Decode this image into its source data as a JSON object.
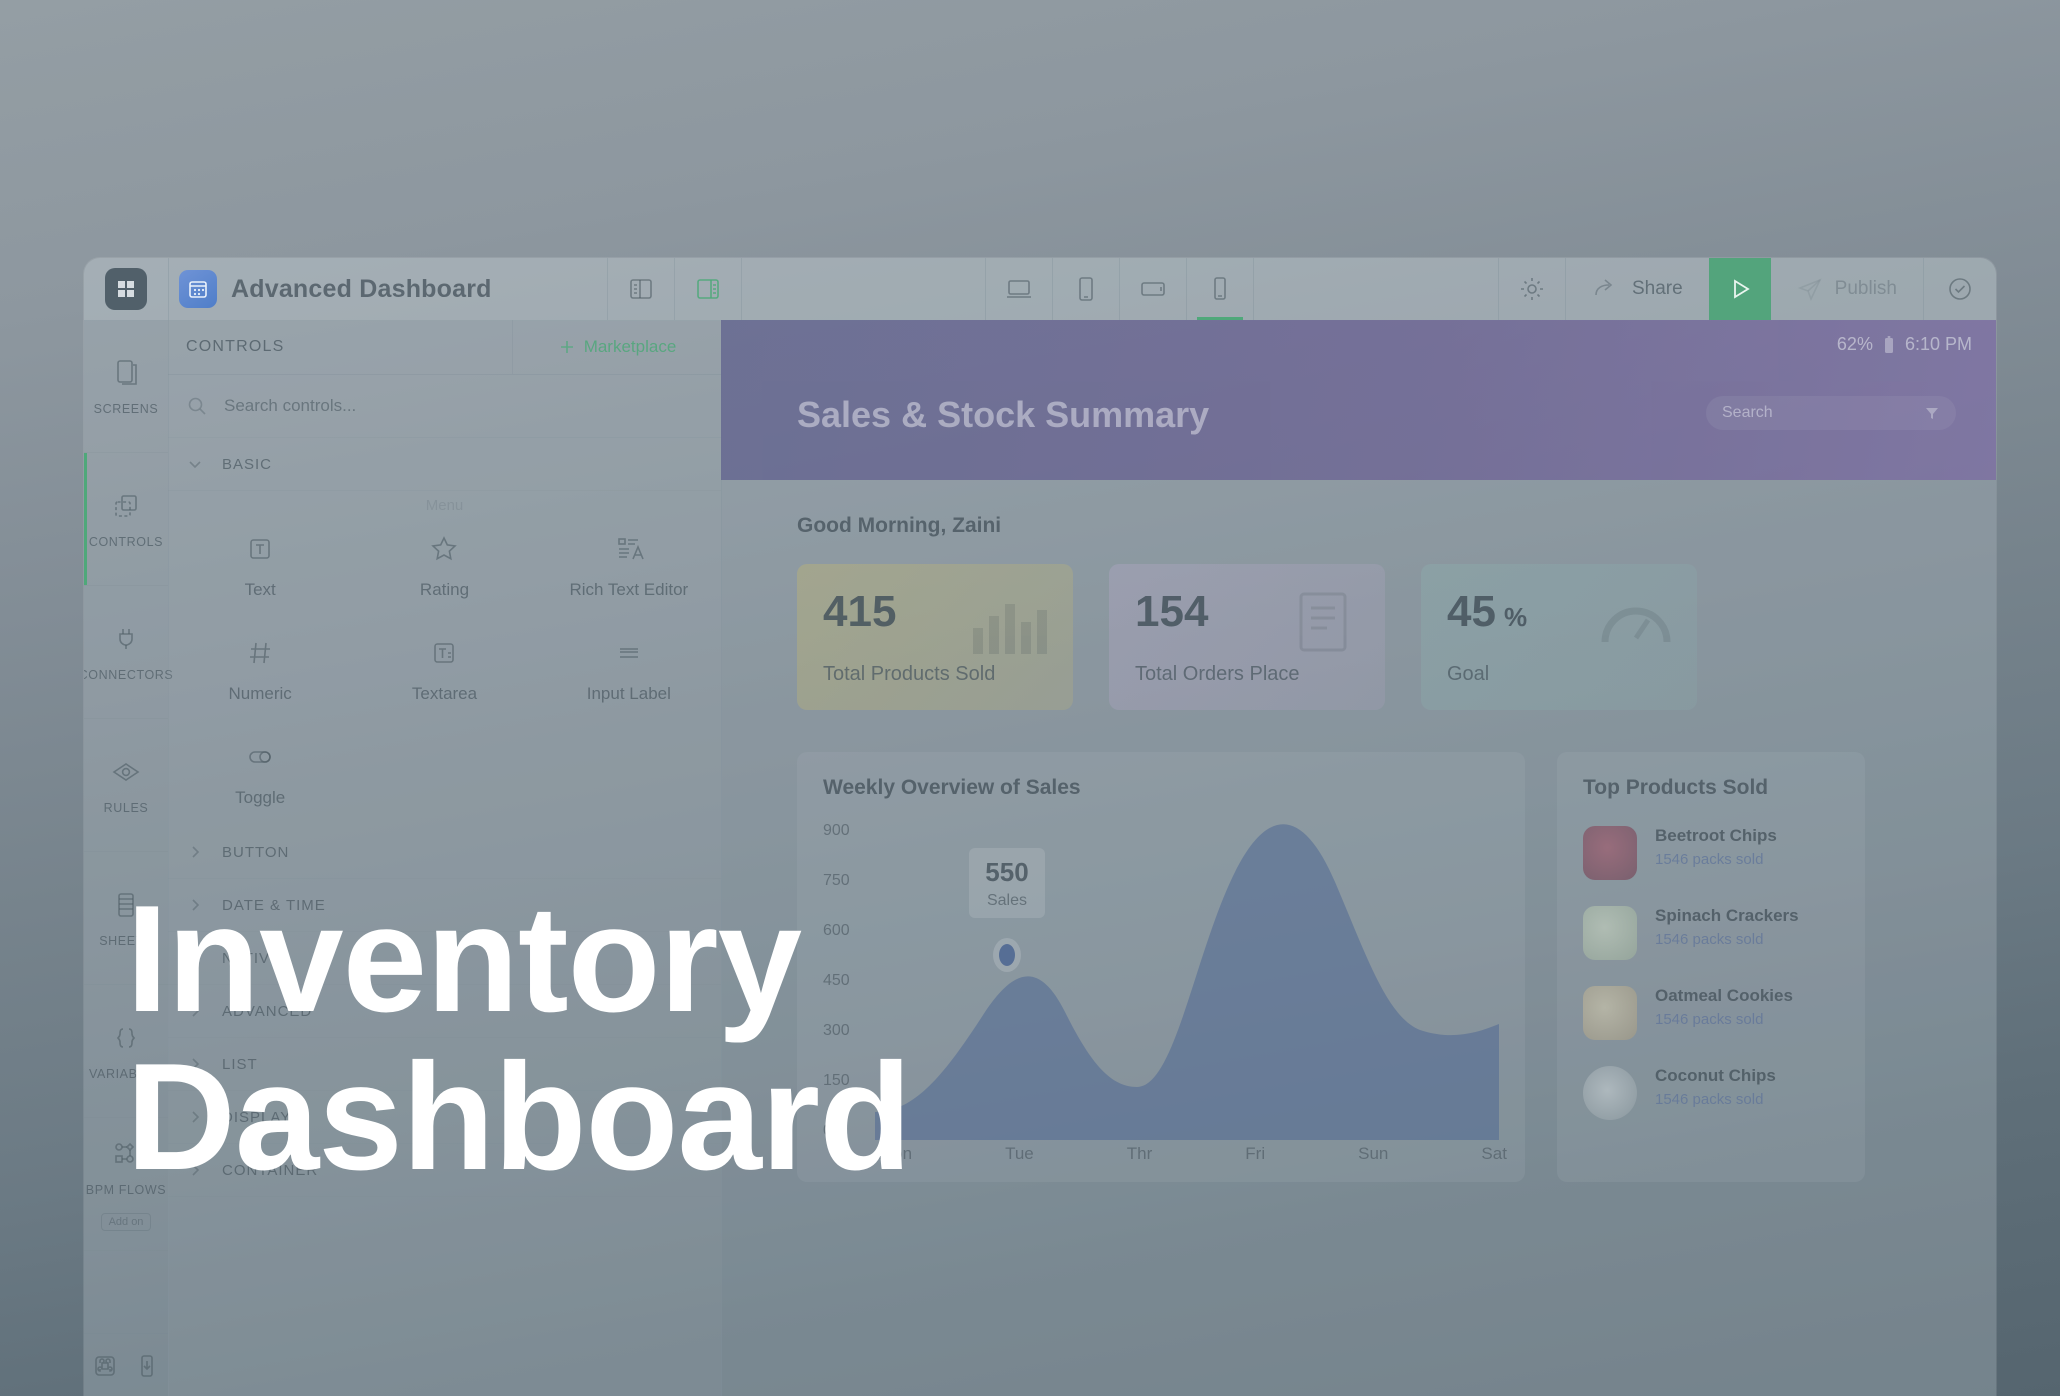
{
  "overlay": {
    "line1": "Inventory",
    "line2": "Dashboard",
    "color": "#ffffff"
  },
  "toolbar": {
    "app_title": "Advanced Dashboard",
    "app_icon": "calendar-app-icon",
    "logo_icon": "brand-logo-icon",
    "layout_buttons": [
      {
        "name": "layout-left-panel-icon",
        "active": false
      },
      {
        "name": "layout-split-panel-icon",
        "active": true
      }
    ],
    "devices": [
      {
        "name": "desktop-icon",
        "active": false
      },
      {
        "name": "tablet-icon",
        "active": false
      },
      {
        "name": "tablet-landscape-icon",
        "active": false
      },
      {
        "name": "mobile-icon",
        "active": true
      }
    ],
    "settings_icon": "gear-icon",
    "share_label": "Share",
    "share_icon": "share-arrow-icon",
    "play_icon": "play-icon",
    "play_bg": "#53a47c",
    "publish_label": "Publish",
    "publish_icon": "paper-plane-icon",
    "check_icon": "check-circle-icon"
  },
  "rail": {
    "items": [
      {
        "label": "SCREENS",
        "icon": "screens-icon",
        "active": false
      },
      {
        "label": "CONTROLS",
        "icon": "controls-icon",
        "active": true
      },
      {
        "label": "CONNECTORS",
        "icon": "plug-icon",
        "active": false
      },
      {
        "label": "RULES",
        "icon": "eye-rules-icon",
        "active": false
      },
      {
        "label": "SHEETS",
        "icon": "sheets-icon",
        "active": false
      },
      {
        "label": "VARIABLES",
        "icon": "braces-icon",
        "active": false
      },
      {
        "label": "BPM FLOWS",
        "icon": "flow-nodes-icon",
        "active": false
      }
    ],
    "badge": "Add on",
    "bottom_icons": [
      "command-icon",
      "download-mobile-icon"
    ]
  },
  "panel": {
    "title": "CONTROLS",
    "marketplace_label": "Marketplace",
    "marketplace_icon": "plus-icon",
    "search_placeholder": "Search controls...",
    "search_icon": "search-icon",
    "basic_label": "BASIC",
    "basic_chevron": "chevron-down-icon",
    "menu_ghost": "Menu",
    "controls": [
      {
        "label": "Text",
        "icon": "text-box-icon"
      },
      {
        "label": "Rating",
        "icon": "star-icon"
      },
      {
        "label": "Rich Text Editor",
        "icon": "rich-text-icon"
      },
      {
        "label": "Numeric",
        "icon": "hash-icon"
      },
      {
        "label": "Textarea",
        "icon": "textarea-icon"
      },
      {
        "label": "Input Label",
        "icon": "input-label-icon"
      },
      {
        "label": "Toggle",
        "icon": "toggle-icon"
      }
    ],
    "groups": [
      {
        "label": "BUTTON",
        "icon": "chevron-right-icon"
      },
      {
        "label": "DATE & TIME",
        "icon": "chevron-right-icon"
      },
      {
        "label": "NATIVE",
        "icon": "chevron-right-icon"
      },
      {
        "label": "ADVANCED",
        "icon": "chevron-right-icon"
      },
      {
        "label": "LIST",
        "icon": "chevron-right-icon"
      },
      {
        "label": "DISPLAY",
        "icon": "chevron-right-icon"
      },
      {
        "label": "CONTAINER",
        "icon": "chevron-right-icon"
      }
    ]
  },
  "preview": {
    "status": {
      "battery": "62%",
      "battery_icon": "battery-icon",
      "time": "6:10 PM"
    },
    "header_title": "Sales & Stock Summary",
    "header_color": "#6a5f93",
    "search_placeholder": "Search",
    "filter_icon": "filter-icon",
    "greeting": "Good Morning, Zaini",
    "stat_cards": [
      {
        "value": "415",
        "unit": "",
        "label": "Total Products Sold",
        "ghost_icon": "bar-chart-icon"
      },
      {
        "value": "154",
        "unit": "",
        "label": "Total Orders Place",
        "ghost_icon": "receipt-icon"
      },
      {
        "value": "45",
        "unit": "%",
        "label": "Goal",
        "ghost_icon": "gauge-icon"
      }
    ],
    "chart_title": "Weekly Overview of Sales",
    "tooltip": {
      "value": "550",
      "label": "Sales"
    },
    "products_title": "Top Products Sold",
    "products": [
      {
        "name": "Beetroot Chips",
        "meta": "1546 packs sold",
        "thumb": "beetroot-chips-thumb"
      },
      {
        "name": "Spinach Crackers",
        "meta": "1546 packs sold",
        "thumb": "spinach-crackers-thumb"
      },
      {
        "name": "Oatmeal Cookies",
        "meta": "1546 packs sold",
        "thumb": "oatmeal-cookies-thumb"
      },
      {
        "name": "Coconut Chips",
        "meta": "1546 packs sold",
        "thumb": "coconut-chips-thumb"
      }
    ]
  },
  "chart_data": {
    "type": "area",
    "title": "Weekly Overview of Sales",
    "xlabel": "",
    "ylabel": "",
    "categories": [
      "Mon",
      "Tue",
      "Thr",
      "Fri",
      "Sun",
      "Sat"
    ],
    "series": [
      {
        "name": "Sales",
        "values": [
          120,
          550,
          180,
          900,
          330,
          300
        ]
      }
    ],
    "yticks": [
      "900",
      "750",
      "600",
      "450",
      "300",
      "150",
      "0"
    ],
    "ylim": [
      0,
      900
    ],
    "grid": false,
    "legend": "none",
    "highlight": {
      "category": "Tue",
      "value": 550,
      "label": "Sales"
    },
    "fill_color": "#4a6491"
  }
}
